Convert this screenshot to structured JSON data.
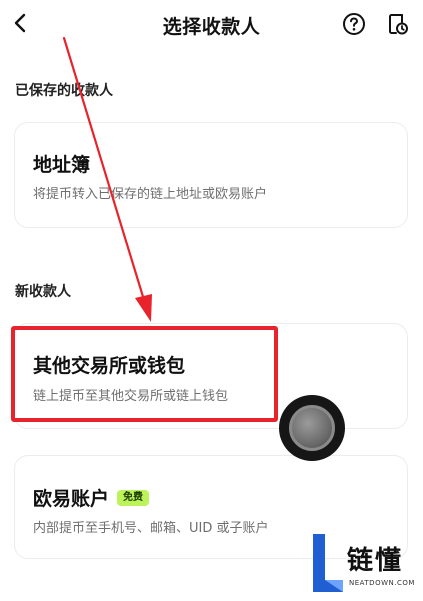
{
  "header": {
    "title": "选择收款人",
    "back_icon": "chevron-left",
    "help_icon": "question-circle",
    "history_icon": "document-clock"
  },
  "saved_section": {
    "label": "已保存的收款人",
    "address_book": {
      "title": "地址簿",
      "description": "将提币转入已保存的链上地址或欧易账户"
    }
  },
  "new_section": {
    "label": "新收款人",
    "other_exchange": {
      "title": "其他交易所或钱包",
      "description": "链上提币至其他交易所或链上钱包"
    },
    "okx_account": {
      "title": "欧易账户",
      "badge": "免费",
      "description": "内部提币至手机号、邮箱、UID 或子账户"
    }
  },
  "watermark": {
    "name": "链懂",
    "site": "NEATDOWN.COM"
  },
  "colors": {
    "highlight": "#e8232c",
    "badge_bg": "#bdf35a",
    "desc_text": "#6f6f6f"
  }
}
